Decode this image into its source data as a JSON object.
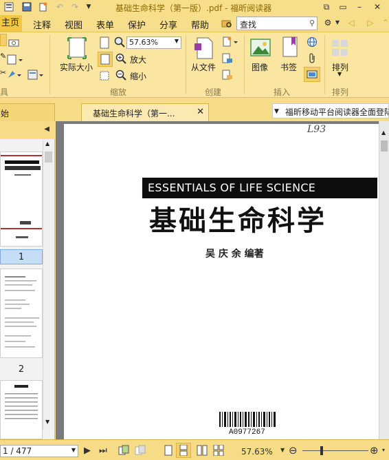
{
  "window": {
    "title": "基础生命科学（第一版）.pdf - 福昕阅读器"
  },
  "menu": {
    "items": [
      "主页",
      "注释",
      "视图",
      "表单",
      "保护",
      "分享",
      "帮助"
    ],
    "active": "主页"
  },
  "search": {
    "placeholder": "查找"
  },
  "ribbon": {
    "actual_size_label": "实际大小",
    "zoom_value": "57.63%",
    "zoom_in_label": "放大",
    "zoom_out_label": "缩小",
    "from_file_label": "从文件",
    "image_label": "图像",
    "bookmark_label": "书签",
    "arrange_label": "排列",
    "groups": {
      "tools": "具",
      "zoom": "缩放",
      "create": "创建",
      "insert": "插入",
      "arrange": "排列"
    }
  },
  "tabs": {
    "first": "始",
    "second": "基础生命科学（第一..."
  },
  "notice": "福昕移动平台阅读器全面登陆",
  "thumbnails": {
    "pages": [
      "1",
      "2"
    ]
  },
  "document": {
    "handnote": "L93",
    "banner": "ESSENTIALS OF LIFE SCIENCE",
    "title": "基础生命科学",
    "author": "吴 庆 余  编著",
    "barcode": "A0977267"
  },
  "status": {
    "page_indicator": "1 / 477",
    "zoom": "57.63%"
  },
  "colors": {
    "ribbon_bg": "#fbe6a1",
    "menu_bg": "#f7de8a",
    "active_tab": "#f3c643",
    "doc_bg": "#7a7a7a"
  }
}
